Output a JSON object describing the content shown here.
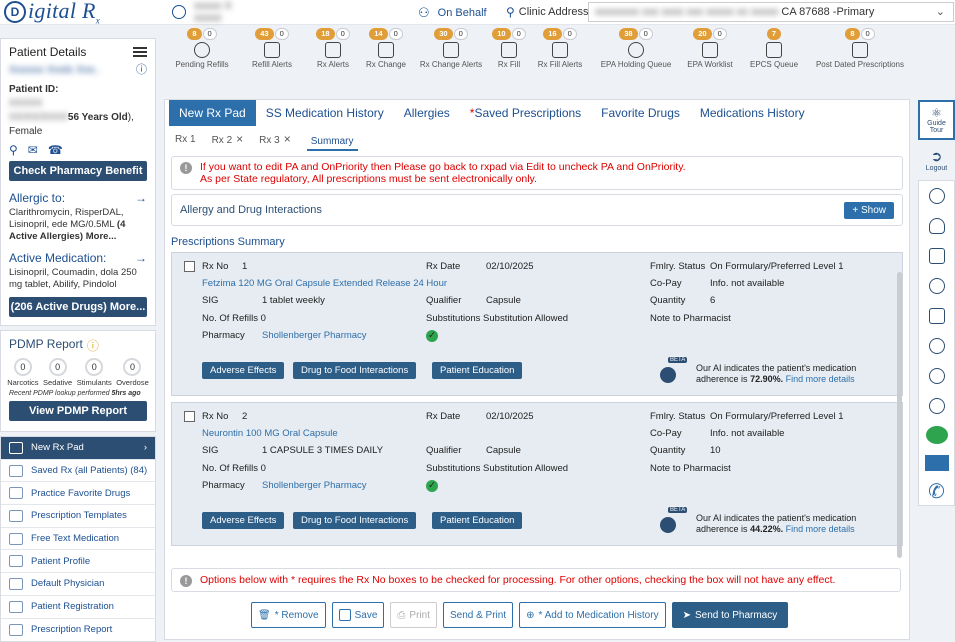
{
  "header": {
    "logo_letter": "D",
    "logo_text": "igital R",
    "logo_sub": "x",
    "user_name_blurred": "xxxxx X xxxxx",
    "on_behalf": "On Behalf",
    "clinic_label": "Clinic Address",
    "clinic_value_blur": "xxxxxxxx xxx xxxx xxx xxxxx xx xxxxx",
    "clinic_value": "CA 87688 -Primary"
  },
  "patient": {
    "section_title": "Patient Details",
    "name_blur": "Xxxxxx Xxxlx Xxx..",
    "id_label": "Patient ID:",
    "id_blur": "XXXXX",
    "dob_blur": "XX/XX/XXXX",
    "age_text": "56 Years Old",
    "gender_text": "), Female",
    "check_pharmacy": "Check Pharmacy Benefit",
    "allergic_title": "Allergic to:",
    "allergic_text": "Clarithromycin, RisperDAL, Lisinopril, ede MG/0.5ML",
    "allergic_more": "(4 Active Allergies) More...",
    "active_med_title": "Active Medication:",
    "active_med_text": "Lisinopril, Coumadin, dola 250 mg tablet, Abilify, Pindolol",
    "active_drugs_btn": "(206 Active Drugs) More..."
  },
  "pdmp": {
    "title": "PDMP Report",
    "circles": [
      {
        "value": "0",
        "label": "Narcotics"
      },
      {
        "value": "0",
        "label": "Sedative"
      },
      {
        "value": "0",
        "label": "Stimulants"
      },
      {
        "value": "0",
        "label": "Overdose"
      }
    ],
    "recent_prefix": "Recent PDMP lookup performed",
    "recent_value": "5hrs ago",
    "view_btn": "View PDMP Report"
  },
  "left_menu": [
    {
      "label": "New Rx Pad",
      "icon": "rx-pad-icon",
      "active": true
    },
    {
      "label": "Saved Rx (all Patients) (84)",
      "icon": "saved-rx-icon"
    },
    {
      "label": "Practice Favorite Drugs",
      "icon": "favorite-drugs-icon"
    },
    {
      "label": "Prescription Templates",
      "icon": "templates-icon"
    },
    {
      "label": "Free Text Medication",
      "icon": "free-text-icon"
    },
    {
      "label": "Patient Profile",
      "icon": "patient-profile-icon"
    },
    {
      "label": "Default Physician",
      "icon": "physician-icon"
    },
    {
      "label": "Patient Registration",
      "icon": "registration-icon"
    },
    {
      "label": "Prescription Report",
      "icon": "report-icon"
    }
  ],
  "toolbar": [
    {
      "count1": "8",
      "count2": "0",
      "label": "Pending Refills",
      "icon": "pending-refills-icon"
    },
    {
      "count1": "43",
      "count2": "0",
      "label": "Refill Alerts",
      "icon": "refill-alert-icon"
    },
    {
      "count1": "18",
      "count2": "0",
      "label": "Rx Alerts",
      "icon": "rx-alert-icon"
    },
    {
      "count1": "14",
      "count2": "0",
      "label": "Rx Change",
      "icon": "rx-change-icon"
    },
    {
      "count1": "30",
      "count2": "0",
      "label": "Rx Change Alerts",
      "icon": "rx-change-alert-icon"
    },
    {
      "count1": "10",
      "count2": "0",
      "label": "Rx Fill",
      "icon": "rx-fill-icon"
    },
    {
      "count1": "16",
      "count2": "0",
      "label": "Rx Fill Alerts",
      "icon": "rx-fill-alert-icon"
    },
    {
      "count1": "38",
      "count2": "0",
      "label": "EPA Holding Queue",
      "icon": "epa-holding-icon"
    },
    {
      "count1": "20",
      "count2": "0",
      "label": "EPA Worklist",
      "icon": "epa-worklist-icon"
    },
    {
      "count1": "7",
      "count2": "",
      "label": "EPCS Queue",
      "icon": "epcs-queue-icon"
    },
    {
      "count1": "8",
      "count2": "0",
      "label": "Post Dated Prescriptions",
      "icon": "post-dated-icon"
    }
  ],
  "tabs": [
    {
      "label": "New Rx Pad",
      "active": true
    },
    {
      "label": "SS Medication History"
    },
    {
      "label": "Allergies"
    },
    {
      "label": "Saved Prescriptions",
      "star": "*"
    },
    {
      "label": "Favorite Drugs"
    },
    {
      "label": "Medications History"
    }
  ],
  "subtabs": {
    "rx1": "Rx 1",
    "rx2": "Rx 2",
    "rx3": "Rx 3",
    "summary": "Summary",
    "close": "×"
  },
  "alert_top": {
    "line1": "If you want to edit PA and OnPriority then Please go back to rxpad via Edit to uncheck PA and OnPriority.",
    "line2": "As per State regulatory, All prescriptions must be sent electronically only."
  },
  "adi": {
    "title": "Allergy and Drug Interactions",
    "show": "Show"
  },
  "summary_title": "Prescriptions Summary",
  "labels": {
    "rx_no": "Rx No",
    "rx_date": "Rx Date",
    "fmlry": "Fmlry. Status",
    "copay": "Co-Pay",
    "sig": "SIG",
    "qualifier": "Qualifier",
    "quantity": "Quantity",
    "refills": "No. Of Refills",
    "substitutions": "Substitutions",
    "note": "Note to Pharmacist",
    "pharmacy": "Pharmacy",
    "adverse": "Adverse Effects",
    "food": "Drug to Food Interactions",
    "education": "Patient Education",
    "ai_prefix": "Our AI indicates the patient's medication adherence is",
    "ai_link": "Find more details",
    "beta": "BETA"
  },
  "prescriptions": [
    {
      "rx_no": "1",
      "drug": "Fetzima 120 MG Oral Capsule Extended Release 24 Hour",
      "rx_date": "02/10/2025",
      "fmlry": "On Formulary/Preferred Level 1",
      "copay": "Info. not available",
      "sig": "1 tablet weekly",
      "qualifier": "Capsule",
      "quantity": "6",
      "refills": "0",
      "substitutions": "Substitution Allowed",
      "pharmacy": "Shollenberger Pharmacy",
      "adherence": "72.90%."
    },
    {
      "rx_no": "2",
      "drug": "Neurontin 100 MG Oral Capsule",
      "rx_date": "02/10/2025",
      "fmlry": "On Formulary/Preferred Level 1",
      "copay": "Info. not available",
      "sig": "1 CAPSULE 3 TIMES DAILY",
      "qualifier": "Capsule",
      "quantity": "10",
      "refills": "0",
      "substitutions": "Substitution Allowed",
      "pharmacy": "Shollenberger Pharmacy",
      "adherence": "44.22%."
    }
  ],
  "alert_bottom": "Options below with * requires the Rx No boxes to be checked for processing. For other options, checking the box will not have any effect.",
  "footer_buttons": {
    "remove": "* Remove",
    "save": "Save",
    "print": "Print",
    "send_print": "Send & Print",
    "add_history": "* Add to Medication History",
    "send_pharmacy": "Send to Pharmacy"
  },
  "right_panel": {
    "guide": "Guide",
    "tour": "Tour",
    "logout": "Logout"
  },
  "colors": {
    "primary": "#2d4e73",
    "accent": "#2d6faa",
    "badge": "#e09d38",
    "alert": "#dd0000",
    "success": "#2ea44f"
  }
}
